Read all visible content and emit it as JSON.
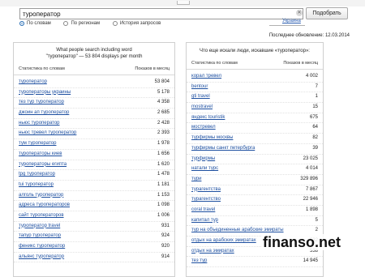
{
  "search": {
    "query": "туроператор",
    "button_label": "Подобрать",
    "clear_icon": "clear-icon"
  },
  "options": {
    "by_words": "По словам",
    "by_regions": "По регионам",
    "history": "История запросов",
    "region_link": "Украина"
  },
  "last_updated": "Последнее обновление: 12.03.2014",
  "left_panel": {
    "header_line1": "What people search including word",
    "header_line2": "\"туроператор\" — 53 804 displays per month",
    "col_phrase": "Статистика по словам",
    "col_count": "Показов в месяц",
    "rows": [
      {
        "phrase": "туроператор",
        "count": "53 804"
      },
      {
        "phrase": "туроператоры украины",
        "count": "5 178"
      },
      {
        "phrase": "тез тур туроператор",
        "count": "4 358"
      },
      {
        "phrase": "джоин ап туроператор",
        "count": "2 685"
      },
      {
        "phrase": "ньюс туроператор",
        "count": "2 428"
      },
      {
        "phrase": "ньюс тревел туроператор",
        "count": "2 393"
      },
      {
        "phrase": "тум туроператор",
        "count": "1 978"
      },
      {
        "phrase": "туроператоры киев",
        "count": "1 656"
      },
      {
        "phrase": "туроператоры египта",
        "count": "1 620"
      },
      {
        "phrase": "tpg туроператор",
        "count": "1 478"
      },
      {
        "phrase": "tui туроператор",
        "count": "1 181"
      },
      {
        "phrase": "алголь туроператор",
        "count": "1 153"
      },
      {
        "phrase": "адреса туроператоров",
        "count": "1 098"
      },
      {
        "phrase": "сайт туроператоров",
        "count": "1 006"
      },
      {
        "phrase": "туроператор travel",
        "count": "931"
      },
      {
        "phrase": "тапур туроператор",
        "count": "924"
      },
      {
        "phrase": "феникс туроператор",
        "count": "920"
      },
      {
        "phrase": "альянс туроператор",
        "count": "914"
      }
    ]
  },
  "right_panel": {
    "header_line1": "Что еще искали люди, искавшие «туроператор»:",
    "col_phrase": "Статистика по словам",
    "col_count": "Показов в месяц",
    "rows": [
      {
        "phrase": "корал тревел",
        "count": "4 002"
      },
      {
        "phrase": "bentour",
        "count": "7"
      },
      {
        "phrase": "gti travel",
        "count": "1"
      },
      {
        "phrase": "mostravel",
        "count": "15"
      },
      {
        "phrase": "яндекс touristik",
        "count": "675"
      },
      {
        "phrase": "мостревел",
        "count": "64"
      },
      {
        "phrase": "турфирмы москвы",
        "count": "82"
      },
      {
        "phrase": "турфирмы санкт петербурга",
        "count": "39"
      },
      {
        "phrase": "турфирмы",
        "count": "23 025"
      },
      {
        "phrase": "натали турс",
        "count": "4 014"
      },
      {
        "phrase": "тури",
        "count": "329 896"
      },
      {
        "phrase": "турагентства",
        "count": "7 867"
      },
      {
        "phrase": "турагентство",
        "count": "22 946"
      },
      {
        "phrase": "coral travel",
        "count": "1 898"
      },
      {
        "phrase": "капитал тур",
        "count": "5"
      },
      {
        "phrase": "тур на объединенные арабские эмираты",
        "count": "2"
      },
      {
        "phrase": "отдых на арабских эмиратах",
        "count": "532"
      },
      {
        "phrase": "отдых на эмиратах",
        "count": "538"
      },
      {
        "phrase": "тез тур",
        "count": "14 945"
      }
    ]
  },
  "watermark": "finanso.net"
}
